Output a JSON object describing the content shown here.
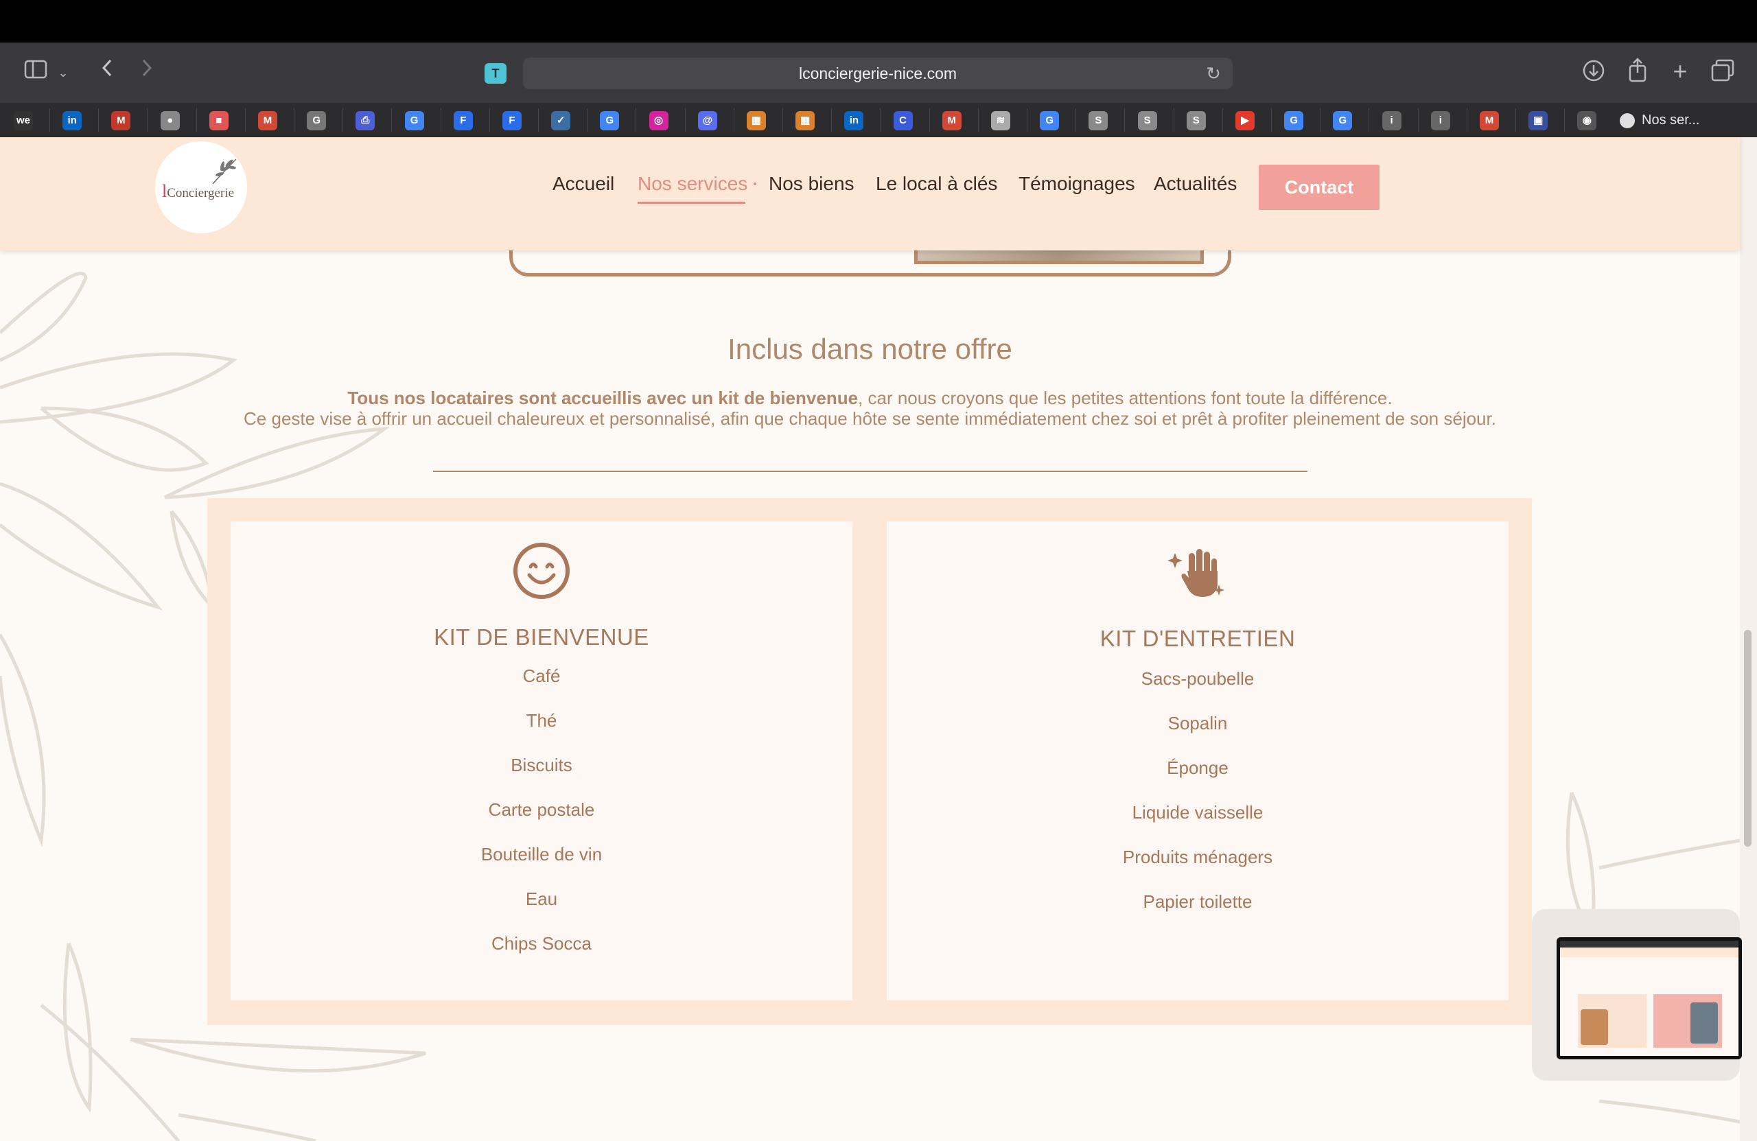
{
  "browser": {
    "url": "lconciergerie-nice.com",
    "tab_title": "Nos ser...",
    "bookmarks": [
      "we",
      "in",
      "M",
      "●",
      "■",
      "M",
      "G",
      "⎙",
      "G",
      "F",
      "F",
      "✓",
      "G",
      "◎",
      "@",
      "▦",
      "▦",
      "in",
      "C",
      "M",
      "≋",
      "G",
      "S",
      "S",
      "S",
      "▶",
      "G",
      "G",
      "i",
      "i",
      "M",
      "▣",
      "◉"
    ],
    "icons": [
      "sidebar-icon",
      "chevron-down-icon",
      "back-icon",
      "forward-icon",
      "reader-icon",
      "reload-icon",
      "download-icon",
      "share-icon",
      "new-tab-icon",
      "tabs-overview-icon"
    ]
  },
  "site": {
    "logo": {
      "prefix": "l",
      "text": "Conciergerie"
    },
    "nav": {
      "items": [
        "Accueil",
        "Nos services",
        "Nos biens",
        "Le local à clés",
        "Témoignages",
        "Actualités"
      ],
      "active": "Nos services"
    },
    "contact_label": "Contact"
  },
  "section": {
    "title": "Inclus dans notre offre",
    "intro_bold": "Tous nos locataires sont accueillis avec un kit de bienvenue",
    "intro_rest": ", car nous croyons que les petites attentions font toute la différence.",
    "intro_line2": "Ce geste vise à offrir un accueil chaleureux et personnalisé, afin que chaque hôte se sente immédiatement chez soi et prêt à profiter pleinement de son séjour."
  },
  "cards": [
    {
      "icon": "smiley-icon",
      "title": "KIT DE BIENVENUE",
      "items": [
        "Café",
        "Thé",
        "Biscuits",
        "Carte postale",
        "Bouteille de vin",
        "Eau",
        "Chips Socca"
      ]
    },
    {
      "icon": "sparkle-hand-icon",
      "title": "KIT D'ENTRETIEN",
      "items": [
        "Sacs-poubelle",
        "Sopalin",
        "Éponge",
        "Liquide vaisselle",
        "Produits ménagers",
        "Papier toilette"
      ]
    }
  ],
  "colors": {
    "accent": "#e48a80",
    "text_brown": "#b0876a",
    "header_bg": "#fde8d8",
    "card_bg": "#fdf8f3"
  }
}
